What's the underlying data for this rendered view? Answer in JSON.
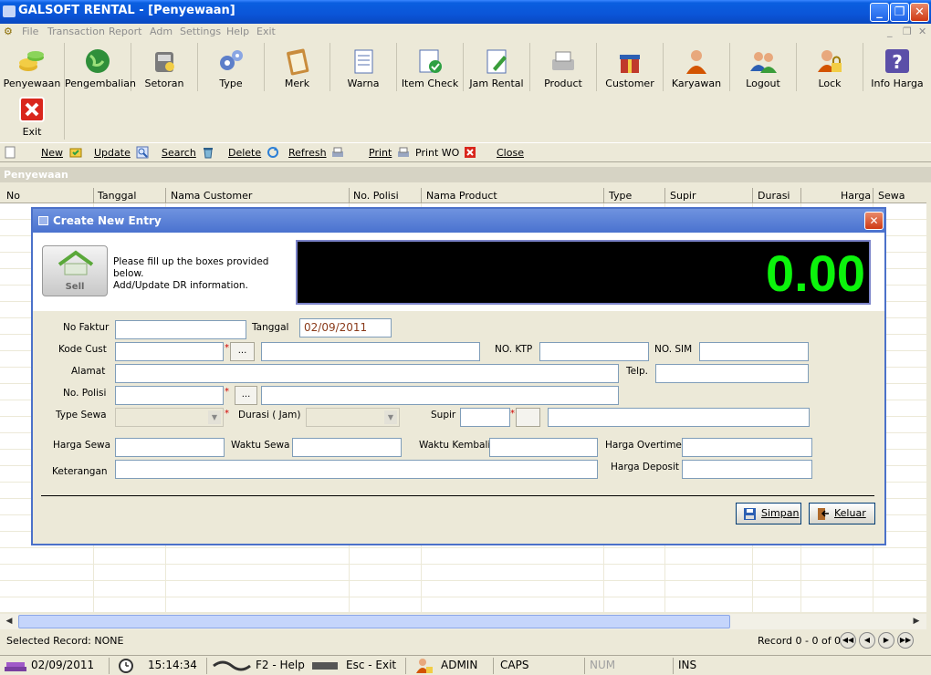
{
  "window": {
    "title": "GALSOFT RENTAL - [Penyewaan]"
  },
  "menu": [
    "File",
    "Transaction",
    "Report",
    "Adm",
    "Settings",
    "Help",
    "Exit"
  ],
  "toolbar": [
    {
      "label": "Penyewaan",
      "icon": "coins-icon"
    },
    {
      "label": "Pengembalian",
      "icon": "globe-icon"
    },
    {
      "label": "Setoran",
      "icon": "cashier-icon"
    },
    {
      "label": "Type",
      "icon": "gears-icon"
    },
    {
      "label": "Merk",
      "icon": "clipboard-icon"
    },
    {
      "label": "Warna",
      "icon": "notepad-icon"
    },
    {
      "label": "Item Check",
      "icon": "check-document-icon"
    },
    {
      "label": "Jam Rental",
      "icon": "edit-document-icon"
    },
    {
      "label": "Product",
      "icon": "printer-icon"
    },
    {
      "label": "Customer",
      "icon": "gift-icon"
    },
    {
      "label": "Karyawan",
      "icon": "person-icon"
    },
    {
      "label": "Logout",
      "icon": "users-icon"
    },
    {
      "label": "Lock",
      "icon": "lock-user-icon"
    },
    {
      "label": "Info Harga",
      "icon": "help-icon"
    },
    {
      "label": "Exit",
      "icon": "exit-icon"
    }
  ],
  "subtoolbar": {
    "new": "New",
    "update": "Update",
    "search": "Search",
    "delete": "Delete",
    "refresh": "Refresh",
    "print": "Print",
    "print_wo": "Print WO",
    "close": "Close"
  },
  "grid": {
    "section_title": "Penyewaan",
    "columns": [
      "No",
      "Tanggal",
      "Nama Customer",
      "No. Polisi",
      "Nama Product",
      "Type",
      "Supir",
      "Durasi",
      "Harga",
      "Sewa"
    ]
  },
  "dialog": {
    "title": "Create New Entry",
    "logo_text": "Sell",
    "message_line1": "Please fill up the boxes provided below.",
    "message_line2": "Add/Update DR information.",
    "amount": "0.00",
    "labels": {
      "no_faktur": "No Faktur",
      "tanggal": "Tanggal",
      "kode_cust": "Kode Cust",
      "no_ktp": "NO. KTP",
      "no_sim": "NO. SIM",
      "alamat": "Alamat",
      "telp": "Telp.",
      "no_polisi": "No. Polisi",
      "type_sewa": "Type Sewa",
      "durasi": "Durasi ( Jam)",
      "supir": "Supir",
      "harga_sewa": "Harga Sewa",
      "waktu_sewa": "Waktu Sewa",
      "waktu_kembali": "Waktu Kembali",
      "harga_overtime": "Harga Overtime",
      "keterangan": "Keterangan",
      "harga_deposit": "Harga Deposit"
    },
    "values": {
      "tanggal": "02/09/2011"
    },
    "browse": "...",
    "required_mark": "*",
    "save_label": "Simpan",
    "exit_label": "Keluar"
  },
  "footer": {
    "selected_record": "Selected Record: NONE",
    "record_count": "Record 0 - 0 of 0"
  },
  "statusbar": {
    "date": "02/09/2011",
    "time": "15:14:34",
    "help": "F2 - Help",
    "exit": "Esc - Exit",
    "user": "ADMIN",
    "caps": "CAPS",
    "num": "NUM",
    "ins": "INS"
  },
  "colors": {
    "amount_text": "#0cf40c",
    "title_bar": "#0a5fe0",
    "dialog_title": "#4a72cf"
  }
}
